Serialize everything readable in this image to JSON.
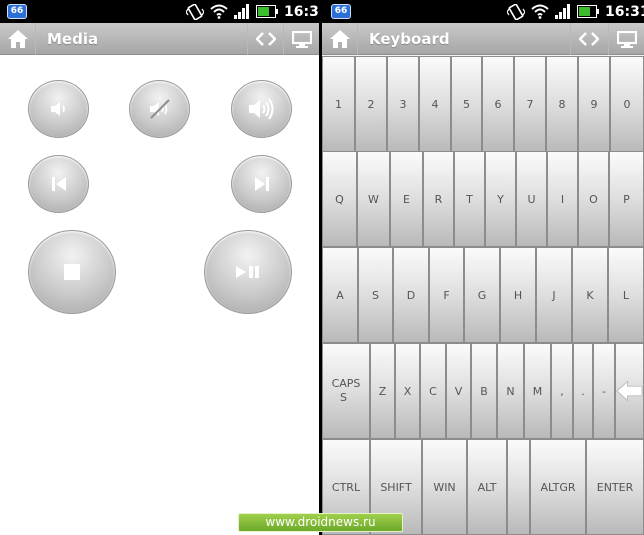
{
  "status_bar": {
    "badge": "66",
    "time": "16:31"
  },
  "media_screen": {
    "title": "Media",
    "buttons": [
      {
        "id": "volume-down"
      },
      {
        "id": "mute"
      },
      {
        "id": "volume-up"
      },
      {
        "id": "previous"
      },
      {
        "id": "next"
      },
      {
        "id": "stop"
      },
      {
        "id": "play-pause"
      }
    ]
  },
  "keyboard_screen": {
    "title": "Keyboard",
    "rows": [
      [
        "1",
        "2",
        "3",
        "4",
        "5",
        "6",
        "7",
        "8",
        "9",
        "0"
      ],
      [
        "Q",
        "W",
        "E",
        "R",
        "T",
        "Y",
        "U",
        "I",
        "O",
        "P"
      ],
      [
        "A",
        "S",
        "D",
        "F",
        "G",
        "H",
        "J",
        "K",
        "L"
      ],
      [
        "CAPS",
        "Z",
        "X",
        "C",
        "V",
        "B",
        "N",
        "M",
        ",",
        ".",
        "-",
        ""
      ],
      [
        "CTRL",
        "SHIFT",
        "WIN",
        "ALT",
        "",
        "ALTGR",
        "ENTER"
      ]
    ]
  },
  "watermark": "www.droidnews.ru",
  "colors": {
    "appbar": "#b5b5b5",
    "badge": "#2b6fd6",
    "watermark": "#84bb37"
  }
}
